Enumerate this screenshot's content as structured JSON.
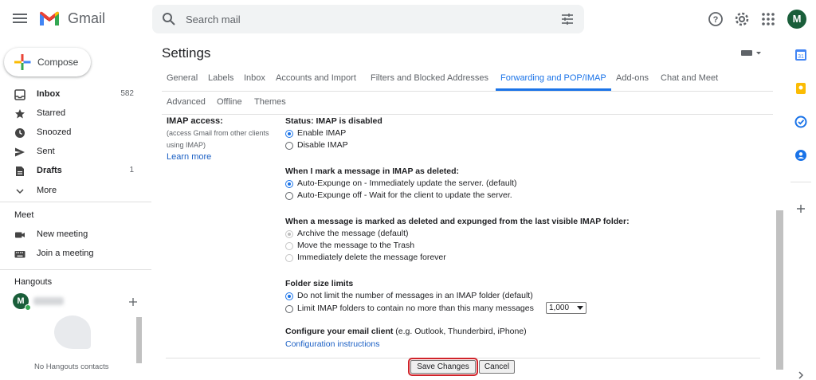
{
  "header": {
    "brand": "Gmail",
    "search_placeholder": "Search mail",
    "avatar_letter": "M"
  },
  "nav": {
    "compose_label": "Compose",
    "items": [
      {
        "label": "Inbox",
        "count": "582",
        "bold": true
      },
      {
        "label": "Starred",
        "count": ""
      },
      {
        "label": "Snoozed",
        "count": ""
      },
      {
        "label": "Sent",
        "count": ""
      },
      {
        "label": "Drafts",
        "count": "1",
        "bold": true
      },
      {
        "label": "More",
        "count": ""
      }
    ],
    "meet_title": "Meet",
    "meet_items": [
      "New meeting",
      "Join a meeting"
    ],
    "hangouts_title": "Hangouts",
    "hangouts_user_letter": "M",
    "hangouts_empty": "No Hangouts contacts"
  },
  "settings": {
    "title": "Settings",
    "tabs_row1": [
      "General",
      "Labels",
      "Inbox",
      "Accounts and Import",
      "Filters and Blocked Addresses",
      "Forwarding and POP/IMAP",
      "Add-ons",
      "Chat and Meet"
    ],
    "tabs_row2": [
      "Advanced",
      "Offline",
      "Themes"
    ],
    "active_tab": "Forwarding and POP/IMAP",
    "imap_label": "IMAP access:",
    "imap_sub1": "(access Gmail from other clients",
    "imap_sub2": "using IMAP)",
    "learn_more": "Learn more",
    "status": "Status: IMAP is disabled",
    "enable_imap": "Enable IMAP",
    "disable_imap": "Disable IMAP",
    "deleted_heading": "When I mark a message in IMAP as deleted:",
    "expunge_on": "Auto-Expunge on - Immediately update the server. (default)",
    "expunge_off": "Auto-Expunge off - Wait for the client to update the server.",
    "expunged_heading": "When a message is marked as deleted and expunged from the last visible IMAP folder:",
    "archive": "Archive the message (default)",
    "trash": "Move the message to the Trash",
    "delete_forever": "Immediately delete the message forever",
    "folder_heading": "Folder size limits",
    "no_limit": "Do not limit the number of messages in an IMAP folder (default)",
    "limit": "Limit IMAP folders to contain no more than this many messages",
    "limit_value": "1,000",
    "client_heading": "Configure your email client",
    "client_examples": " (e.g. Outlook, Thunderbird, iPhone)",
    "config_link": "Configuration instructions",
    "save": "Save Changes",
    "cancel": "Cancel"
  },
  "colors": {
    "accent": "#1a73e8",
    "highlight": "#d0232a"
  }
}
